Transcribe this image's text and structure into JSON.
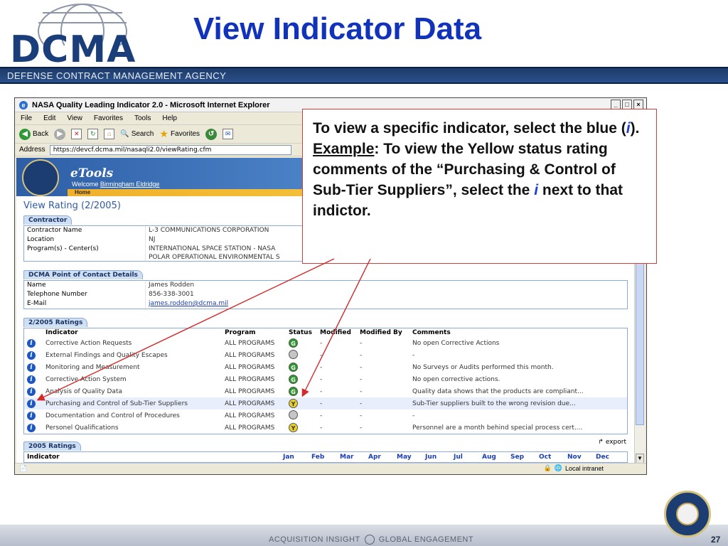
{
  "slide": {
    "logo_text": "DCMA",
    "title": "View Indicator Data",
    "agency": "DEFENSE CONTRACT MANAGEMENT AGENCY",
    "footer_left": "ACQUISITION INSIGHT",
    "footer_right": "GLOBAL ENGAGEMENT",
    "page_number": "27"
  },
  "browser": {
    "title": "NASA Quality Leading Indicator 2.0 - Microsoft Internet Explorer",
    "menu": [
      "File",
      "Edit",
      "View",
      "Favorites",
      "Tools",
      "Help"
    ],
    "toolbar": {
      "back": "Back",
      "search": "Search",
      "favorites": "Favorites"
    },
    "address_label": "Address",
    "address_url": "https://devcf.dcma.mil/nasaqli2.0/viewRating.cfm",
    "status_zone": "Local intranet"
  },
  "etools": {
    "name": "eTools",
    "welcome_prefix": "Welcome",
    "user": "Birmingham Eldridge",
    "home": "Home"
  },
  "page": {
    "heading": "View Rating (2/2005)",
    "contractor_tab": "Contractor",
    "contractor": [
      {
        "k": "Contractor Name",
        "v": "L-3 COMMUNICATIONS CORPORATION"
      },
      {
        "k": "Location",
        "v": "NJ"
      },
      {
        "k": "Program(s) - Center(s)",
        "v": "INTERNATIONAL SPACE STATION - NASA"
      },
      {
        "k": "",
        "v": "POLAR OPERATIONAL ENVIRONMENTAL S"
      }
    ],
    "poc_tab": "DCMA Point of Contact Details",
    "poc": [
      {
        "k": "Name",
        "v": "James Rodden"
      },
      {
        "k": "Telephone Number",
        "v": "856-338-3001"
      },
      {
        "k": "E-Mail",
        "v": "james.rodden@dcma.mil"
      }
    ],
    "ratings_tab": "2/2005 Ratings",
    "ratings_headers": {
      "indicator": "Indicator",
      "program": "Program",
      "status": "Status",
      "modified": "Modified",
      "modified_by": "Modified By",
      "comments": "Comments"
    },
    "ratings": [
      {
        "indicator": "Corrective Action Requests",
        "program": "ALL PROGRAMS",
        "status": "green",
        "modified": "-",
        "modified_by": "-",
        "comments": "No open Corrective Actions"
      },
      {
        "indicator": "External Findings and Quality Escapes",
        "program": "ALL PROGRAMS",
        "status": "grey",
        "modified": "-",
        "modified_by": "-",
        "comments": "-"
      },
      {
        "indicator": "Monitoring and Measurement",
        "program": "ALL PROGRAMS",
        "status": "green",
        "modified": "-",
        "modified_by": "-",
        "comments": "No Surveys or Audits performed this month."
      },
      {
        "indicator": "Corrective Action System",
        "program": "ALL PROGRAMS",
        "status": "green",
        "modified": "-",
        "modified_by": "-",
        "comments": "No open corrective actions."
      },
      {
        "indicator": "Analysis of Quality Data",
        "program": "ALL PROGRAMS",
        "status": "green",
        "modified": "-",
        "modified_by": "-",
        "comments": "Quality data shows that the products are compliant..."
      },
      {
        "indicator": "Purchasing and Control of Sub-Tier Suppliers",
        "program": "ALL PROGRAMS",
        "status": "yellow",
        "modified": "-",
        "modified_by": "-",
        "comments": "Sub-Tier suppliers built to the wrong revision due..."
      },
      {
        "indicator": "Documentation and Control of Procedures",
        "program": "ALL PROGRAMS",
        "status": "grey",
        "modified": "-",
        "modified_by": "-",
        "comments": "-"
      },
      {
        "indicator": "Personel Qualifications",
        "program": "ALL PROGRAMS",
        "status": "yellow",
        "modified": "-",
        "modified_by": "-",
        "comments": "Personnel are a month behind special process cert...."
      }
    ],
    "annual_tab": "2005 Ratings",
    "export_label": "export",
    "annual_indicator": "Indicator",
    "months": [
      "Jan",
      "Feb",
      "Mar",
      "Apr",
      "May",
      "Jun",
      "Jul",
      "Aug",
      "Sep",
      "Oct",
      "Nov",
      "Dec"
    ]
  },
  "callout": {
    "line1": "To view a specific indicator, select the blue (",
    "i": "i",
    "line2": ").",
    "example": "Example",
    "line3": ": To view the Yellow status rating comments of the “Purchasing & Control of Sub-Tier Suppliers”, select the ",
    "line4": " next to that indictor."
  },
  "colors": {
    "title_blue": "#1133bb",
    "agency_bar": "#1d3b6a",
    "callout_border": "#c84242",
    "status_green": "#2f9a2f",
    "status_yellow": "#e8d12a",
    "status_grey": "#c5c5c5"
  }
}
